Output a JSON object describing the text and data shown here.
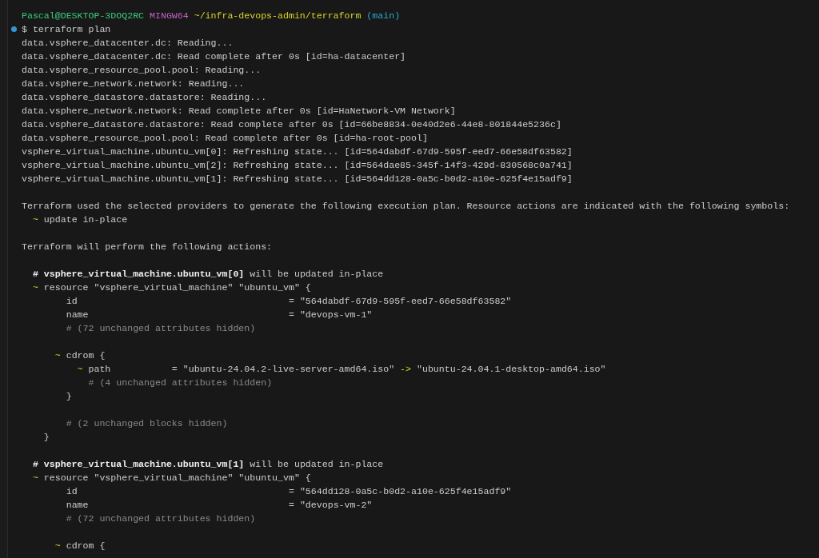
{
  "lines": [
    {
      "kind": "prompt",
      "segments": [
        {
          "text": "Pascal@DESKTOP-3DOQ2RC",
          "kind": "user"
        },
        {
          "text": "MINGW64",
          "kind": "shell"
        },
        {
          "text": "~/infra-devops-admin/terraform",
          "kind": "path"
        },
        {
          "text": "(main)",
          "kind": "branch"
        }
      ]
    },
    {
      "kind": "command",
      "segments": [
        {
          "text": "$ terraform plan",
          "kind": "plain"
        }
      ]
    },
    {
      "kind": "output",
      "segments": [
        {
          "text": "data.vsphere_datacenter.dc: Reading...",
          "kind": "plain"
        }
      ]
    },
    {
      "kind": "output",
      "segments": [
        {
          "text": "data.vsphere_datacenter.dc: Read complete after 0s [id=ha-datacenter]",
          "kind": "plain"
        }
      ]
    },
    {
      "kind": "output",
      "segments": [
        {
          "text": "data.vsphere_resource_pool.pool: Reading...",
          "kind": "plain"
        }
      ]
    },
    {
      "kind": "output",
      "segments": [
        {
          "text": "data.vsphere_network.network: Reading...",
          "kind": "plain"
        }
      ]
    },
    {
      "kind": "output",
      "segments": [
        {
          "text": "data.vsphere_datastore.datastore: Reading...",
          "kind": "plain"
        }
      ]
    },
    {
      "kind": "output",
      "segments": [
        {
          "text": "data.vsphere_network.network: Read complete after 0s [id=HaNetwork-VM Network]",
          "kind": "plain"
        }
      ]
    },
    {
      "kind": "output",
      "segments": [
        {
          "text": "data.vsphere_datastore.datastore: Read complete after 0s [id=66be8834-0e40d2e6-44e8-801844e5236c]",
          "kind": "plain"
        }
      ]
    },
    {
      "kind": "output",
      "segments": [
        {
          "text": "data.vsphere_resource_pool.pool: Read complete after 0s [id=ha-root-pool]",
          "kind": "plain"
        }
      ]
    },
    {
      "kind": "output",
      "segments": [
        {
          "text": "vsphere_virtual_machine.ubuntu_vm[0]: Refreshing state... [id=564dabdf-67d9-595f-eed7-66e58df63582]",
          "kind": "plain"
        }
      ]
    },
    {
      "kind": "output",
      "segments": [
        {
          "text": "vsphere_virtual_machine.ubuntu_vm[2]: Refreshing state... [id=564dae85-345f-14f3-429d-830568c0a741]",
          "kind": "plain"
        }
      ]
    },
    {
      "kind": "output",
      "segments": [
        {
          "text": "vsphere_virtual_machine.ubuntu_vm[1]: Refreshing state... [id=564dd128-0a5c-b0d2-a10e-625f4e15adf9]",
          "kind": "plain"
        }
      ]
    },
    {
      "kind": "blank"
    },
    {
      "kind": "output",
      "segments": [
        {
          "text": "Terraform used the selected providers to generate the following execution plan. Resource actions are indicated with the following symbols:",
          "kind": "plain"
        }
      ]
    },
    {
      "kind": "output",
      "segments": [
        {
          "text": "  ~",
          "kind": "accent"
        },
        {
          "text": "update in-place",
          "kind": "plain"
        }
      ]
    },
    {
      "kind": "blank"
    },
    {
      "kind": "output",
      "segments": [
        {
          "text": "Terraform will perform the following actions:",
          "kind": "plain"
        }
      ]
    },
    {
      "kind": "blank"
    },
    {
      "kind": "output",
      "segments": [
        {
          "text": "  # vsphere_virtual_machine.ubuntu_vm[0]",
          "kind": "bold"
        },
        {
          "text": "will be updated in-place",
          "kind": "plain"
        }
      ]
    },
    {
      "kind": "output",
      "segments": [
        {
          "text": "  ~",
          "kind": "accent"
        },
        {
          "text": "resource \"vsphere_virtual_machine\" \"ubuntu_vm\" {",
          "kind": "plain"
        }
      ]
    },
    {
      "kind": "output",
      "segments": [
        {
          "text": "        id                                      = \"564dabdf-67d9-595f-eed7-66e58df63582\"",
          "kind": "plain"
        }
      ]
    },
    {
      "kind": "output",
      "segments": [
        {
          "text": "        name                                    = \"devops-vm-1\"",
          "kind": "plain"
        }
      ]
    },
    {
      "kind": "output",
      "segments": [
        {
          "text": "        # (72 unchanged attributes hidden)",
          "kind": "dim"
        }
      ]
    },
    {
      "kind": "blank"
    },
    {
      "kind": "output",
      "segments": [
        {
          "text": "      ~",
          "kind": "accent"
        },
        {
          "text": "cdrom {",
          "kind": "plain"
        }
      ]
    },
    {
      "kind": "output",
      "segments": [
        {
          "text": "          ~",
          "kind": "accent"
        },
        {
          "text": "path           = \"ubuntu-24.04.2-live-server-amd64.iso\"",
          "kind": "plain"
        },
        {
          "text": "->",
          "kind": "accent"
        },
        {
          "text": "\"ubuntu-24.04.1-desktop-amd64.iso\"",
          "kind": "plain"
        }
      ]
    },
    {
      "kind": "output",
      "segments": [
        {
          "text": "            # (4 unchanged attributes hidden)",
          "kind": "dim"
        }
      ]
    },
    {
      "kind": "output",
      "segments": [
        {
          "text": "        }",
          "kind": "plain"
        }
      ]
    },
    {
      "kind": "blank"
    },
    {
      "kind": "output",
      "segments": [
        {
          "text": "        # (2 unchanged blocks hidden)",
          "kind": "dim"
        }
      ]
    },
    {
      "kind": "output",
      "segments": [
        {
          "text": "    }",
          "kind": "plain"
        }
      ]
    },
    {
      "kind": "blank"
    },
    {
      "kind": "output",
      "segments": [
        {
          "text": "  # vsphere_virtual_machine.ubuntu_vm[1]",
          "kind": "bold"
        },
        {
          "text": "will be updated in-place",
          "kind": "plain"
        }
      ]
    },
    {
      "kind": "output",
      "segments": [
        {
          "text": "  ~",
          "kind": "accent"
        },
        {
          "text": "resource \"vsphere_virtual_machine\" \"ubuntu_vm\" {",
          "kind": "plain"
        }
      ]
    },
    {
      "kind": "output",
      "segments": [
        {
          "text": "        id                                      = \"564dd128-0a5c-b0d2-a10e-625f4e15adf9\"",
          "kind": "plain"
        }
      ]
    },
    {
      "kind": "output",
      "segments": [
        {
          "text": "        name                                    = \"devops-vm-2\"",
          "kind": "plain"
        }
      ]
    },
    {
      "kind": "output",
      "segments": [
        {
          "text": "        # (72 unchanged attributes hidden)",
          "kind": "dim"
        }
      ]
    },
    {
      "kind": "blank"
    },
    {
      "kind": "output",
      "segments": [
        {
          "text": "      ~",
          "kind": "accent"
        },
        {
          "text": "cdrom {",
          "kind": "plain"
        }
      ]
    }
  ]
}
